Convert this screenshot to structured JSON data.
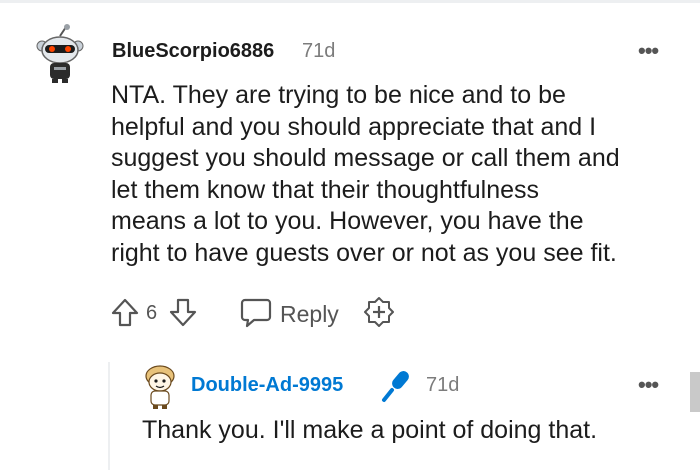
{
  "comment": {
    "username": "BlueScorpio6886",
    "age": "71d",
    "more_icon": "more-horizontal-icon",
    "body_lines": [
      "NTA. They are trying to be nice and to be",
      "helpful and you should appreciate that and I",
      "suggest you should message or call them and",
      "let them know that their thoughtfulness",
      "means a lot to you. However, you have the",
      "right to have guests over or not as you see fit."
    ],
    "votes": "6",
    "reply_label": "Reply"
  },
  "reply": {
    "username": "Double-Ad-9995",
    "flair_icon": "microphone-icon",
    "age": "71d",
    "more_icon": "more-horizontal-icon",
    "body": "Thank you. I'll make a point of doing that."
  },
  "colors": {
    "text": "#1c1c1c",
    "muted": "#7c7c7c",
    "op_username": "#0079d3",
    "accent": "#ff4500"
  }
}
